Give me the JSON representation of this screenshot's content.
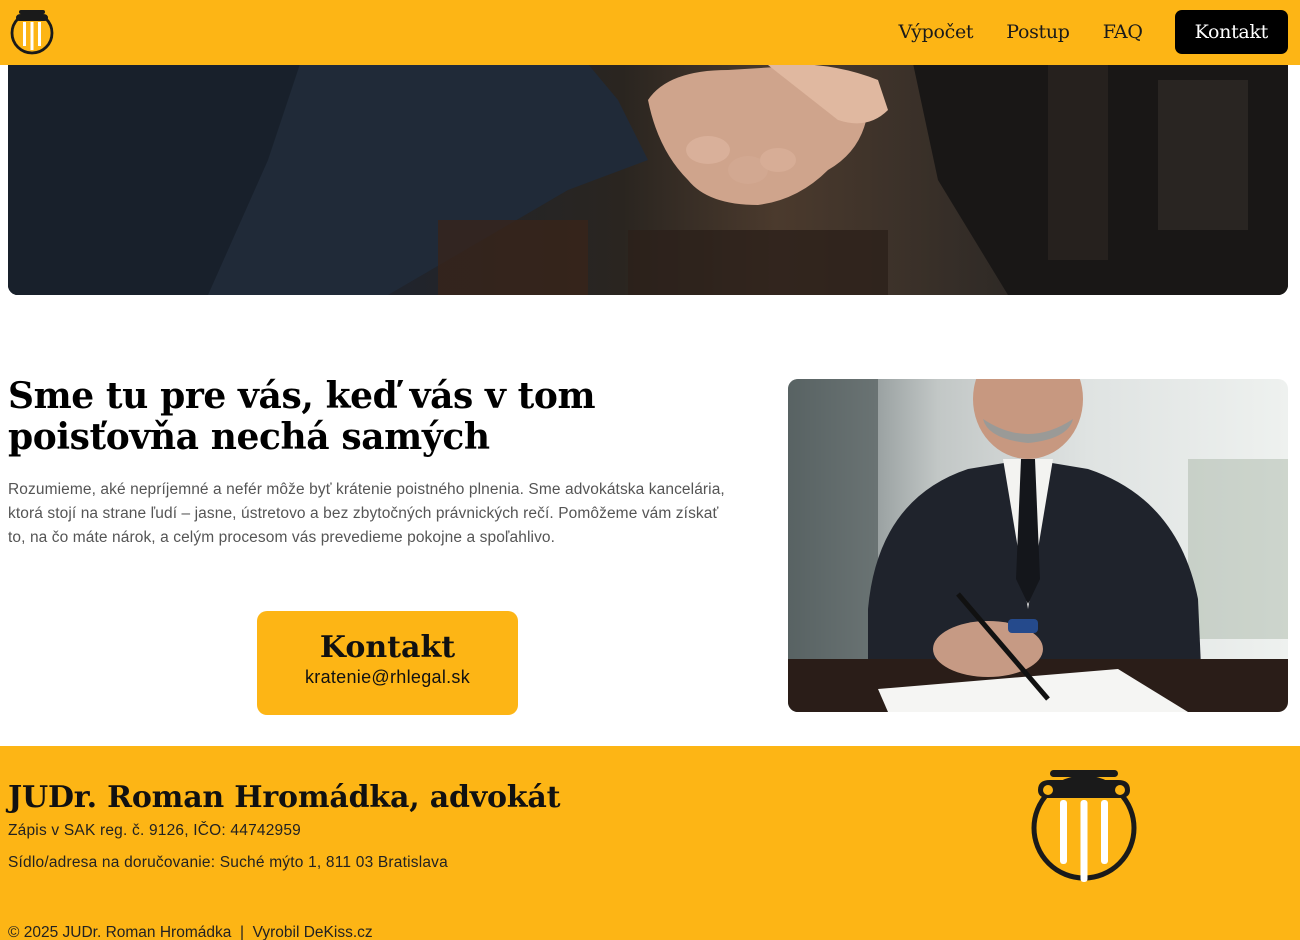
{
  "nav": {
    "items": [
      {
        "label": "Výpočet"
      },
      {
        "label": "Postup"
      },
      {
        "label": "FAQ"
      }
    ],
    "contact_label": "Kontakt"
  },
  "intro": {
    "title_line1": "Sme tu pre vás, keď vás v tom",
    "title_line2": "poisťovňa nechá samých",
    "body": "Rozumieme, aké nepríjemné a nefér môže byť krátenie poistného plnenia. Sme advokátska kancelária, ktorá stojí na strane ľudí – jasne, ústretovo a bez zbytočných právnických rečí. Pomôžeme vám získať to, na čo máte nárok, a celým procesom vás prevedieme pokojne a spoľahlivo."
  },
  "cta": {
    "title": "Kontakt",
    "email": "kratenie@rhlegal.sk"
  },
  "footer": {
    "name": "JUDr. Roman Hromádka, advokát",
    "registration": "Zápis v SAK reg. č. 9126, IČO: 44742959",
    "address": "Sídlo/adresa na doručovanie: Suché mýto 1, 811 03 Bratislava",
    "copyright": "© 2025 JUDr. Roman Hromádka",
    "separator": "|",
    "credit": "Vyrobil DeKiss.cz"
  },
  "colors": {
    "brand": "#fdb515",
    "dark": "#000000"
  },
  "icons": {
    "logo": "column-pillar-icon"
  }
}
